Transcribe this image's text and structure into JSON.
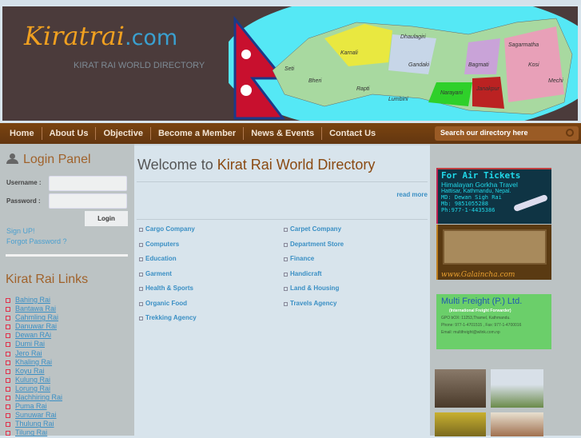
{
  "header": {
    "logo_main": "Kiratrai",
    "logo_suffix": ".com",
    "tagline": "KIRAT RAI WORLD DIRECTORY",
    "map_labels": [
      "Seti",
      "Bheri",
      "Karnali",
      "Rapti",
      "Dhaulagiri",
      "Gandaki",
      "Lumbini",
      "Narayani",
      "Bagmati",
      "Janakpur",
      "Sagarmatha",
      "Kosi",
      "Mechi"
    ]
  },
  "nav": {
    "items": [
      "Home",
      "About Us",
      "Objective",
      "Become a Member",
      "News & Events",
      "Contact Us"
    ],
    "search_placeholder": "Search our directory here"
  },
  "login": {
    "title": "Login Panel",
    "username_label": "Username :",
    "password_label": "Password :",
    "username": "",
    "password": "",
    "login_button": "Login",
    "signup": "Sign UP!",
    "forgot": "Forgot Password ?"
  },
  "links": {
    "title": "Kirat Rai Links",
    "items": [
      "Bahing Rai",
      "Bantawa Rai",
      "Cahmling Rai",
      "Danuwar Rai",
      "Dewan RAi",
      "Dumi Rai",
      "Jero Rai",
      "Khaling Rai",
      "Koyu Rai",
      "Kulung Rai",
      "Lorung Rai",
      "Nachhiring Rai",
      "Puma Rai",
      "Sunuwar Rai",
      "Thulung Rai",
      "Tilung Rai"
    ]
  },
  "main": {
    "welcome": "Welcome to ",
    "title": "Kirat Rai World Directory",
    "read_more": "read more",
    "categories_left": [
      "Cargo Company",
      "Computers",
      "Education",
      "Garment",
      "Health & Sports",
      "Organic Food",
      "Trekking Agency"
    ],
    "categories_right": [
      "Carpet Company",
      "Department Store",
      "Finance",
      "Handicraft",
      "Land & Housing",
      "Travels Agency"
    ]
  },
  "ads": {
    "air": {
      "title": "For Air Tickets",
      "company": "Himalayan Gorkha Travel",
      "address": "Hattisar, Kathmandu, Nepal.",
      "md": "MD: Dewan Sigh Rai",
      "mob": "Mb: 9851055288",
      "ph": "Ph:977-1-4435386"
    },
    "galaincha": "www.Galaincha.com",
    "freight": {
      "name": "Multi Freight (P.) Ltd.",
      "sub": "(International Freight Forwarder)",
      "pobox": "GPO bOX: 11253,Thamel, Kathmandu.",
      "phone": "Phone: 977-1-4701515 , Fax: 977-1-4700016",
      "email": "Email: multifreight@wlink.com.np"
    }
  }
}
